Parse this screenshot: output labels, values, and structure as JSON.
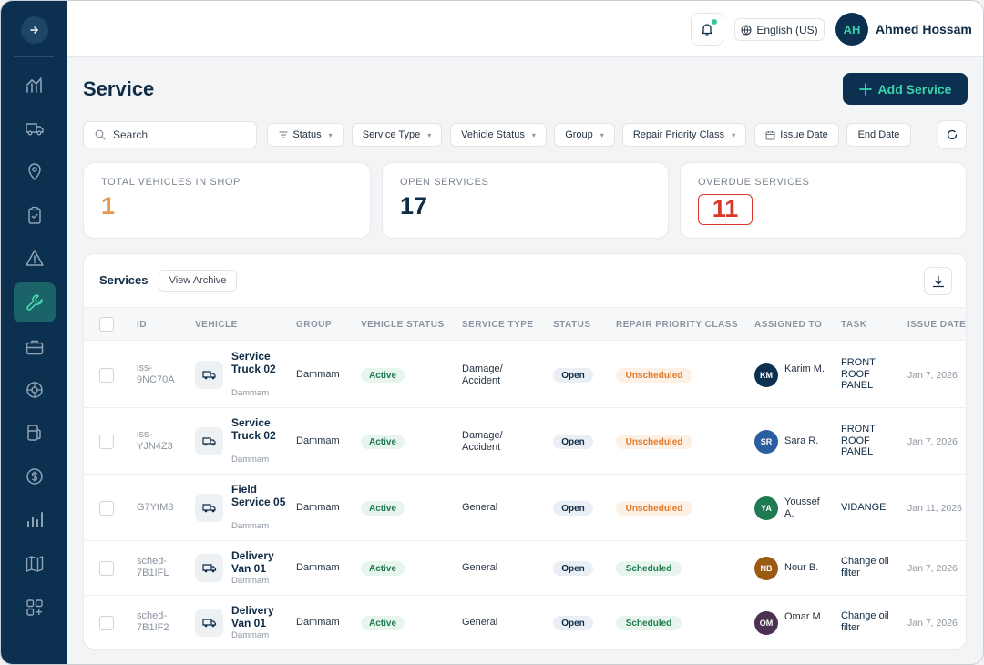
{
  "topbar": {
    "language": "English (US)",
    "user_initials": "AH",
    "user_name": "Ahmed Hossam"
  },
  "sidebar": {
    "items": [
      {
        "icon": "dashboard-chart-icon",
        "active": false
      },
      {
        "icon": "truck-icon",
        "active": false
      },
      {
        "icon": "location-pin-icon",
        "active": false
      },
      {
        "icon": "clipboard-check-icon",
        "active": false
      },
      {
        "icon": "warning-icon",
        "active": false
      },
      {
        "icon": "wrench-icon",
        "active": true
      },
      {
        "icon": "briefcase-icon",
        "active": false
      },
      {
        "icon": "tire-icon",
        "active": false
      },
      {
        "icon": "fuel-icon",
        "active": false
      },
      {
        "icon": "dollar-icon",
        "active": false
      },
      {
        "icon": "bar-chart-icon",
        "active": false
      },
      {
        "icon": "map-icon",
        "active": false
      },
      {
        "icon": "apps-add-icon",
        "active": false
      }
    ]
  },
  "header": {
    "title": "Service",
    "add_button": "Add Service"
  },
  "filters": {
    "search_placeholder": "Search",
    "status": "Status",
    "service_type": "Service Type",
    "vehicle_status": "Vehicle Status",
    "group": "Group",
    "repair_priority_class": "Repair Priority Class",
    "issue_date": "Issue Date",
    "end_date": "End Date"
  },
  "stats": {
    "total_label": "TOTAL VEHICLES IN SHOP",
    "total_value": "1",
    "open_label": "OPEN SERVICES",
    "open_value": "17",
    "overdue_label": "OVERDUE SERVICES",
    "overdue_value": "11"
  },
  "table": {
    "title": "Services",
    "view_archive": "View Archive",
    "columns": [
      "ID",
      "VEHICLE",
      "GROUP",
      "VEHICLE STATUS",
      "SERVICE TYPE",
      "STATUS",
      "REPAIR PRIORITY CLASS",
      "ASSIGNED TO",
      "TASK",
      "ISSUE DATE"
    ],
    "rows": [
      {
        "id": "iss-9NC70A",
        "vehicle": "Service Truck 02",
        "vehicle_group": "Dammam",
        "group": "Dammam",
        "vehicle_status": "Active",
        "service_type": "Damage/ Accident",
        "status": "Open",
        "priority": "Unscheduled",
        "assignee_initials": "KM",
        "assignee": "Karim M.",
        "assignee_color": "#0c3150",
        "task": "FRONT ROOF PANEL",
        "issue_date": "Jan 7, 2026"
      },
      {
        "id": "iss-YJN4Z3",
        "vehicle": "Service Truck 02",
        "vehicle_group": "Dammam",
        "group": "Dammam",
        "vehicle_status": "Active",
        "service_type": "Damage/ Accident",
        "status": "Open",
        "priority": "Unscheduled",
        "assignee_initials": "SR",
        "assignee": "Sara R.",
        "assignee_color": "#2a5ea0",
        "task": "FRONT ROOF PANEL",
        "issue_date": "Jan 7, 2026"
      },
      {
        "id": "G7YtM8",
        "vehicle": "Field Service 05",
        "vehicle_group": "Dammam",
        "group": "Dammam",
        "vehicle_status": "Active",
        "service_type": "General",
        "status": "Open",
        "priority": "Unscheduled",
        "assignee_initials": "YA",
        "assignee": "Youssef A.",
        "assignee_color": "#1d7a52",
        "task": "VIDANGE",
        "issue_date": "Jan 11, 2026"
      },
      {
        "id": "sched-7B1IFL",
        "vehicle": "Delivery Van 01",
        "vehicle_group": "Dammam",
        "group": "Dammam",
        "vehicle_status": "Active",
        "service_type": "General",
        "status": "Open",
        "priority": "Scheduled",
        "assignee_initials": "NB",
        "assignee": "Nour B.",
        "assignee_color": "#9a5a12",
        "task": "Change oil filter",
        "issue_date": "Jan 7, 2026"
      },
      {
        "id": "sched-7B1IF2",
        "vehicle": "Delivery Van 01",
        "vehicle_group": "Dammam",
        "group": "Dammam",
        "vehicle_status": "Active",
        "service_type": "General",
        "status": "Open",
        "priority": "Scheduled",
        "assignee_initials": "OM",
        "assignee": "Omar M.",
        "assignee_color": "#4b3252",
        "task": "Change oil filter",
        "issue_date": "Jan 7, 2026"
      }
    ]
  }
}
